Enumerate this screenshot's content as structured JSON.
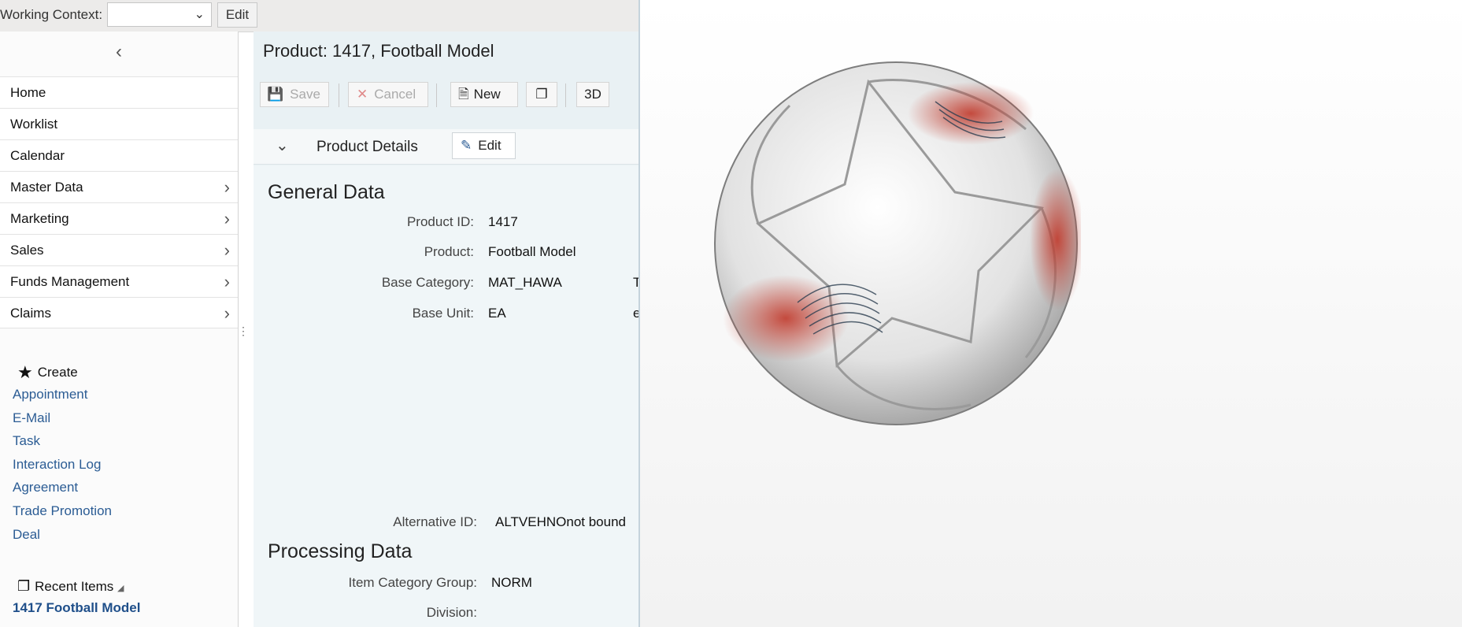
{
  "topbar": {
    "working_context_label": "Working Context:",
    "working_context_value": "",
    "edit_label": "Edit"
  },
  "nav": {
    "items": [
      {
        "label": "Home",
        "has_children": false
      },
      {
        "label": "Worklist",
        "has_children": false
      },
      {
        "label": "Calendar",
        "has_children": false
      },
      {
        "label": "Master Data",
        "has_children": true
      },
      {
        "label": "Marketing",
        "has_children": true
      },
      {
        "label": "Sales",
        "has_children": true
      },
      {
        "label": "Funds Management",
        "has_children": true
      },
      {
        "label": "Claims",
        "has_children": true
      }
    ],
    "create_label": "Create",
    "create_links": [
      "Appointment",
      "E-Mail",
      "Task",
      "Interaction Log",
      "Agreement",
      "Trade Promotion",
      "Deal"
    ],
    "recent_label": "Recent Items",
    "recent_items": [
      "1417 Football Model"
    ]
  },
  "main": {
    "title": "Product: 1417, Football Model",
    "toolbar": {
      "save": "Save",
      "cancel": "Cancel",
      "new": "New",
      "three_d": "3D"
    },
    "section": {
      "title": "Product Details",
      "edit": "Edit"
    },
    "general_data": {
      "title": "General Data",
      "fields": [
        {
          "label": "Product ID:",
          "value": "1417",
          "clipped": ""
        },
        {
          "label": "Product:",
          "value": "Football Model",
          "clipped": ""
        },
        {
          "label": "Base Category:",
          "value": "MAT_HAWA",
          "clipped": "T"
        },
        {
          "label": "Base Unit:",
          "value": "EA",
          "clipped": "e"
        }
      ],
      "alternative_id": {
        "label": "Alternative ID:",
        "value": "ALTVEHNOnot bound"
      }
    },
    "processing_data": {
      "title": "Processing Data",
      "fields": [
        {
          "label": "Item Category Group:",
          "value": "NORM"
        },
        {
          "label": "Division:",
          "value": ""
        }
      ]
    }
  },
  "colors": {
    "link": "#2b5c94",
    "panel_bg": "#e9f1f4",
    "accent_red": "#c0392b"
  }
}
